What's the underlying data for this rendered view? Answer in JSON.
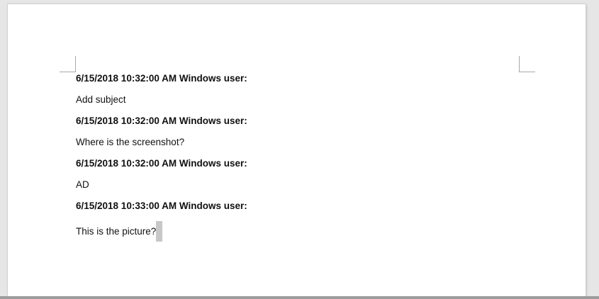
{
  "comments": [
    {
      "header": "6/15/2018 10:32:00 AM Windows user:",
      "text": "Add subject"
    },
    {
      "header": "6/15/2018 10:32:00 AM Windows user:",
      "text": "Where is the screenshot?"
    },
    {
      "header": "6/15/2018 10:32:00 AM Windows user:",
      "text": "AD"
    },
    {
      "header": "6/15/2018 10:33:00 AM Windows user:",
      "text": "This is the picture?"
    }
  ]
}
